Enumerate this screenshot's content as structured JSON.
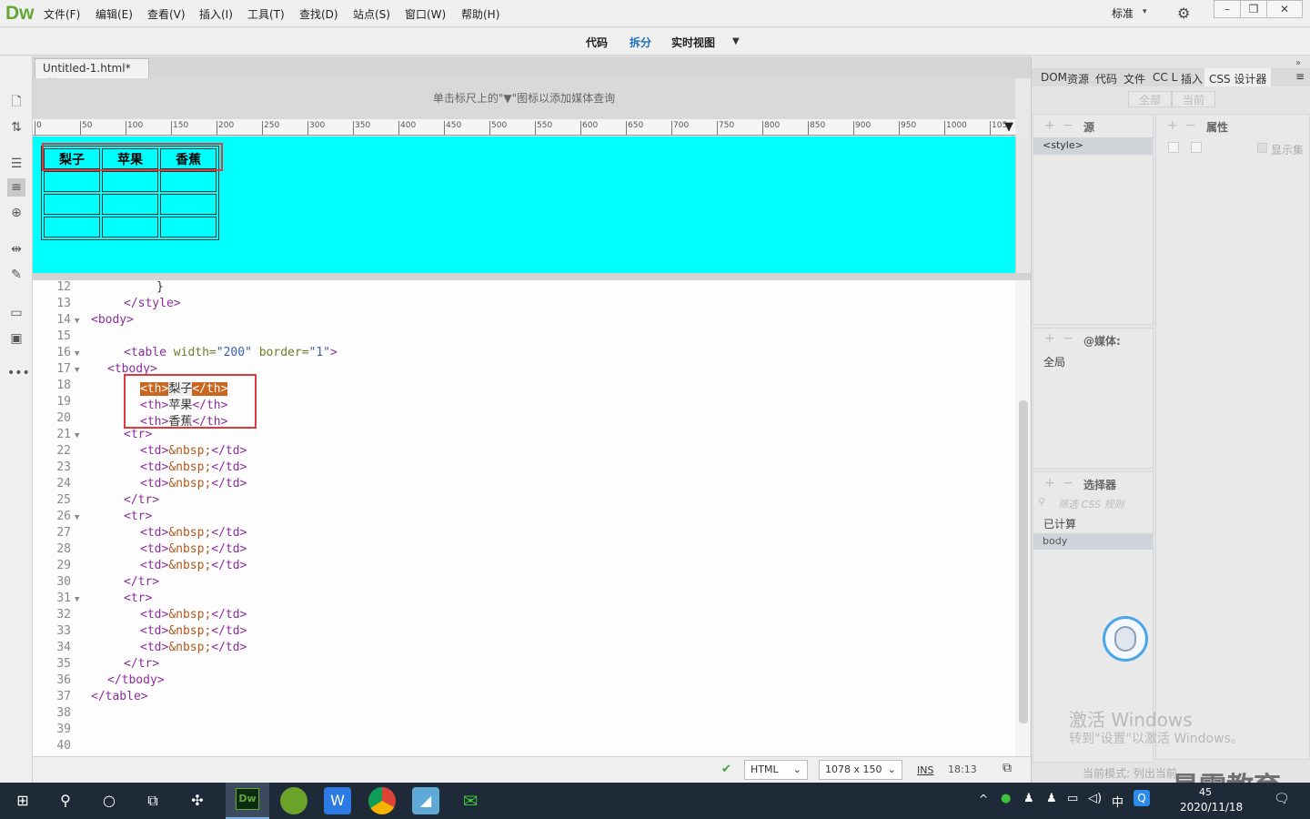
{
  "app": {
    "logo": "Dw"
  },
  "menu": [
    "文件(F)",
    "编辑(E)",
    "查看(V)",
    "插入(I)",
    "工具(T)",
    "查找(D)",
    "站点(S)",
    "窗口(W)",
    "帮助(H)"
  ],
  "workspace": "标准",
  "view_buttons": {
    "code": "代码",
    "split": "拆分",
    "live": "实时视图"
  },
  "document": {
    "tab": "Untitled-1.html*",
    "close": "×"
  },
  "media_query_hint": "单击标尺上的\"▼\"图标以添加媒体查询",
  "ruler_ticks": [
    "0",
    "50",
    "100",
    "150",
    "200",
    "250",
    "300",
    "350",
    "400",
    "450",
    "500",
    "550",
    "600",
    "650",
    "700",
    "750",
    "800",
    "850",
    "900",
    "950",
    "1000",
    "105"
  ],
  "design_table": {
    "headers": [
      "梨子",
      "苹果",
      "香蕉"
    ],
    "empty_rows": 3
  },
  "code": {
    "line_numbers": [
      "12",
      "13",
      "14",
      "15",
      "16",
      "17",
      "18",
      "19",
      "20",
      "21",
      "22",
      "23",
      "24",
      "25",
      "26",
      "27",
      "28",
      "29",
      "30",
      "31",
      "32",
      "33",
      "34",
      "35",
      "36",
      "37",
      "38",
      "39",
      "40"
    ],
    "lines": {
      "l12": "}",
      "l13": "</style>",
      "l14": "<body>",
      "l16a": "<table ",
      "l16b": "width=",
      "l16c": "\"200\"",
      "l16d": " border=",
      "l16e": "\"1\"",
      "l16f": ">",
      "l17": "<tbody>",
      "th_open": "<th>",
      "th_close": "</th>",
      "fruit1": "梨子",
      "fruit2": "苹果",
      "fruit3": "香蕉",
      "tr_open": "<tr>",
      "tr_close": "</tr>",
      "td_open": "<td>",
      "nbsp": "&nbsp;",
      "td_close": "</td>",
      "tbody_close": "</tbody>",
      "table_close": "</table>"
    }
  },
  "status": {
    "lang": "HTML",
    "size": "1078 x 150",
    "mode": "INS",
    "pos": "18:13"
  },
  "right_panel": {
    "tabs": [
      "DOM",
      "资源",
      "代码",
      "文件",
      "CC L",
      "插入",
      "CSS 设计器"
    ],
    "toggle_all": "全部",
    "toggle_current": "当前",
    "source_title": "源",
    "source_item": "<style>",
    "props_title": "属性",
    "show_set": "显示集",
    "media_title": "@媒体:",
    "media_item": "全局",
    "selector_title": "选择器",
    "selector_filter": "筛选 CSS 规则",
    "computed": "已计算",
    "selector_item": "body",
    "mode_text": "当前模式: 列出当前"
  },
  "watermark": {
    "line1": "激活 Windows",
    "line2": "转到\"设置\"以激活 Windows。"
  },
  "brand": "最需教育",
  "taskbar": {
    "date": "2020/11/18",
    "time": "45",
    "ime": "中"
  }
}
